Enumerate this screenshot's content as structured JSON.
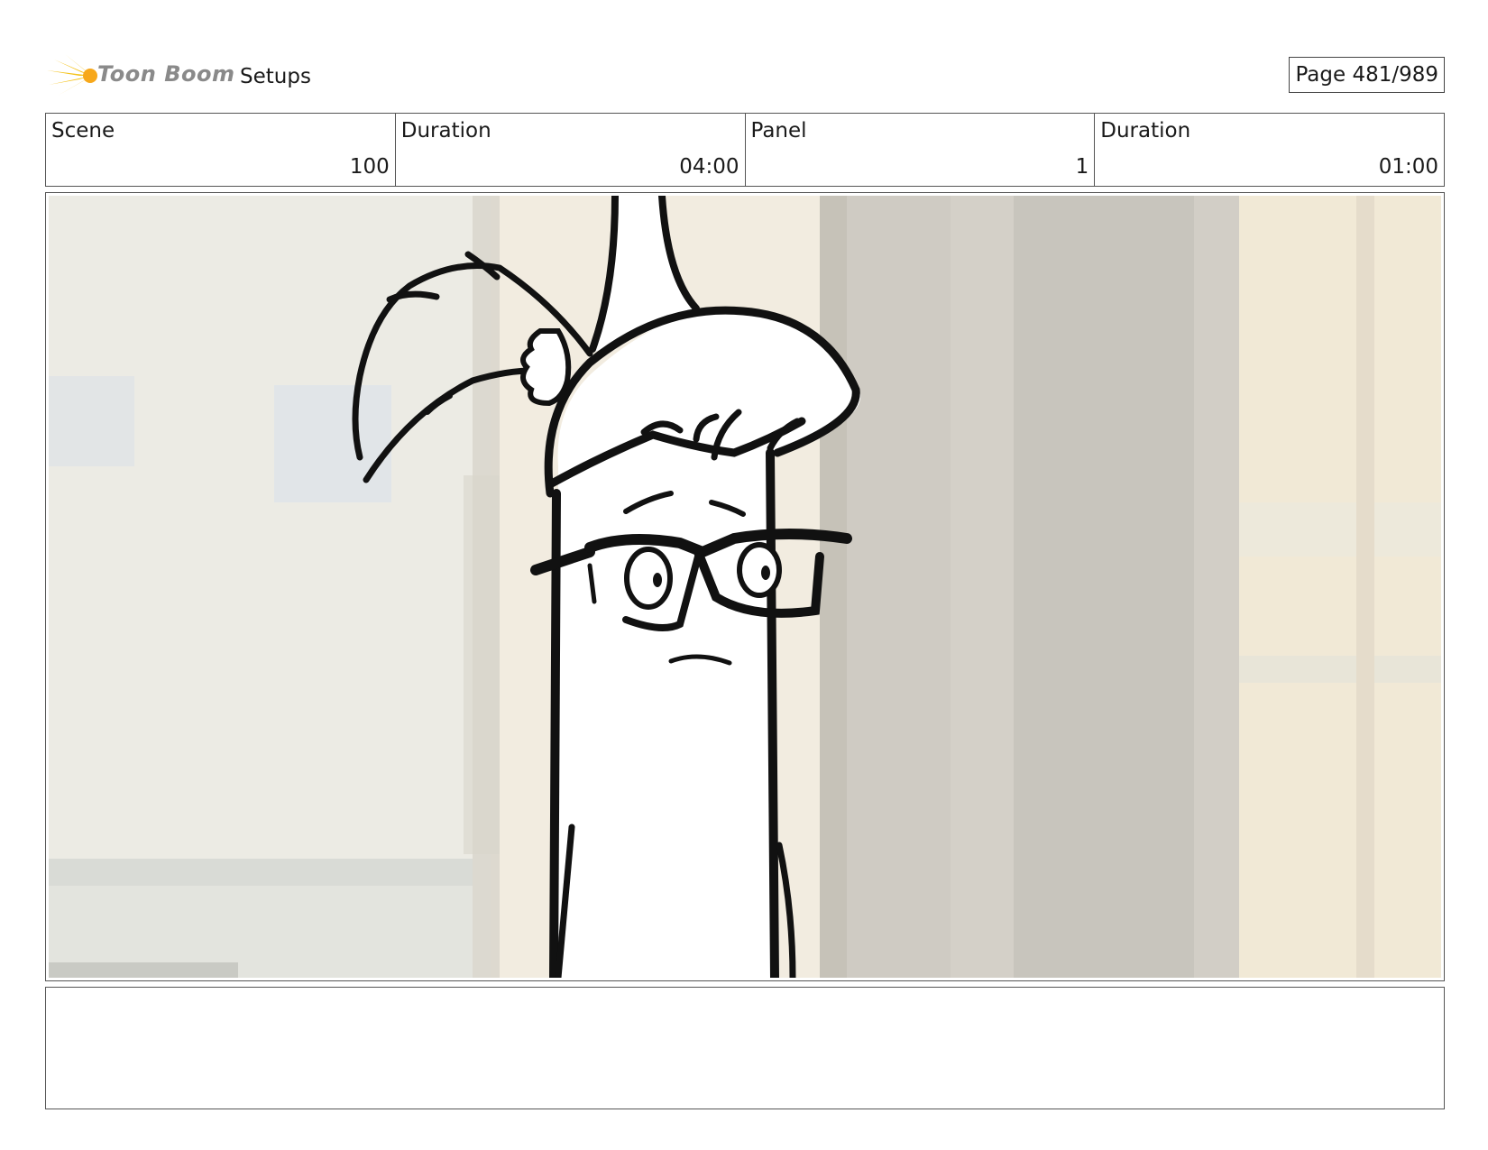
{
  "header": {
    "logo_text": "Toon Boom",
    "section_title": "Setups",
    "page_label": "Page 481/989"
  },
  "info": {
    "scene_label": "Scene",
    "scene_value": "100",
    "scene_duration_label": "Duration",
    "scene_duration_value": "04:00",
    "panel_label": "Panel",
    "panel_value": "1",
    "panel_duration_label": "Duration",
    "panel_duration_value": "01:00"
  },
  "notes": {
    "text": ""
  }
}
